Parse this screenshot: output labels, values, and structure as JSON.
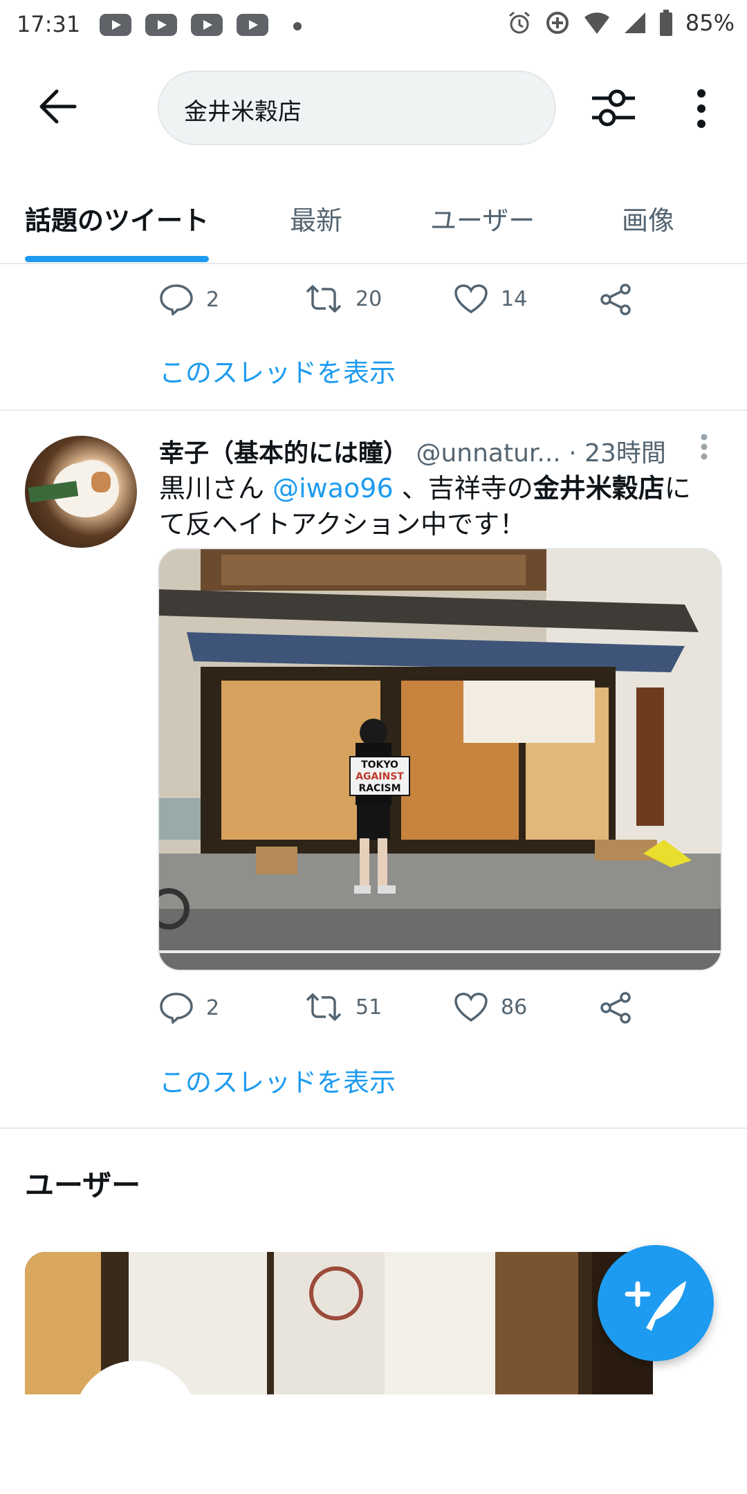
{
  "status_bar": {
    "time": "17:31",
    "battery": "85%"
  },
  "search": {
    "query": "金井米穀店"
  },
  "tabs": [
    {
      "label": "話題のツイート",
      "active": true
    },
    {
      "label": "最新"
    },
    {
      "label": "ユーザー"
    },
    {
      "label": "画像"
    }
  ],
  "tweet1": {
    "replies": "2",
    "retweets": "20",
    "likes": "14",
    "show_thread": "このスレッドを表示"
  },
  "tweet2": {
    "name": "幸子（基本的には瞳）",
    "handle": "@unnatur...",
    "time": "· 23時間",
    "text_before": "黒川さん ",
    "mention": "@iwao96",
    "text_mid": " 、吉祥寺の",
    "text_bold": "金井米穀店",
    "text_after": "にて反ヘイトアクション中です！",
    "sign_text": [
      "TOKYO",
      "AGAINST",
      "RACISM"
    ],
    "replies": "2",
    "retweets": "51",
    "likes": "86",
    "show_thread": "このスレッドを表示"
  },
  "users_section": {
    "title": "ユーザー"
  },
  "colors": {
    "accent": "#1d9bf0",
    "text": "#0f1419",
    "muted": "#536471"
  }
}
